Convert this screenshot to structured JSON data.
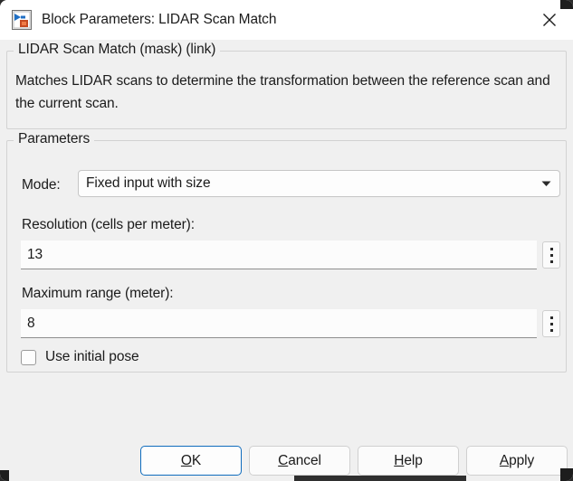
{
  "window": {
    "title": "Block Parameters: LIDAR Scan Match",
    "icon": "simulink-block-icon",
    "close_icon": "close-icon"
  },
  "description": {
    "legend": "LIDAR Scan Match (mask) (link)",
    "text": "Matches LIDAR scans to determine the transformation between the reference scan and the current scan."
  },
  "parameters": {
    "legend": "Parameters",
    "mode": {
      "label": "Mode:",
      "value": "Fixed input with size",
      "arrow_icon": "chevron-down-icon"
    },
    "resolution": {
      "label": "Resolution (cells per meter):",
      "value": "13",
      "more_icon": "vertical-ellipsis-icon"
    },
    "max_range": {
      "label": "Maximum range (meter):",
      "value": "8",
      "more_icon": "vertical-ellipsis-icon"
    },
    "use_initial_pose": {
      "label": "Use initial pose",
      "checked": false
    }
  },
  "buttons": {
    "ok": {
      "mnemonic": "O",
      "rest": "K"
    },
    "cancel": {
      "mnemonic": "C",
      "rest": "ancel"
    },
    "help": {
      "mnemonic": "H",
      "rest": "elp"
    },
    "apply": {
      "mnemonic": "A",
      "rest": "pply"
    }
  },
  "colors": {
    "dialog_bg": "#f0f0f0",
    "titlebar_bg": "#ffffff",
    "accent": "#0f6cbd",
    "text": "#1b1b1b",
    "border": "#d2d2d2"
  }
}
